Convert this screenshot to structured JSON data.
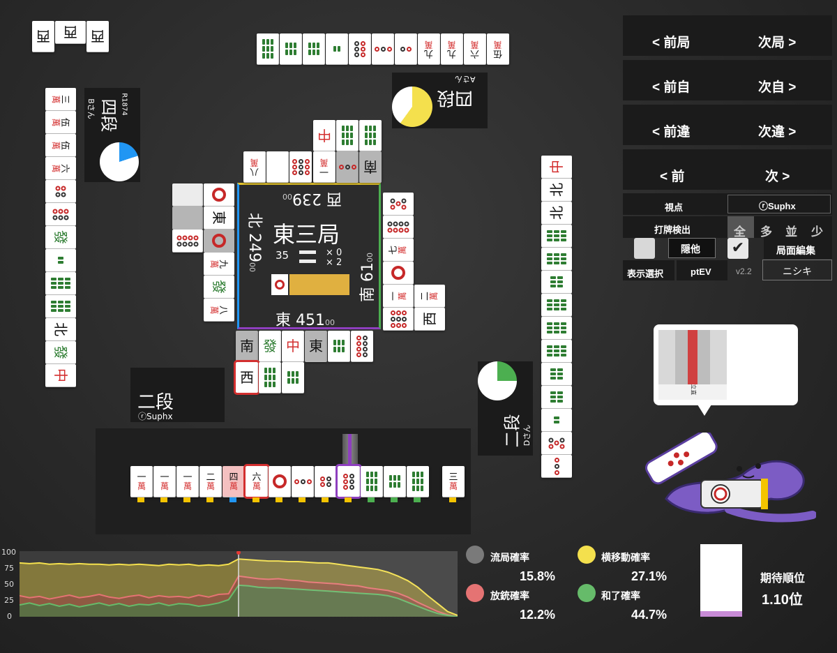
{
  "nav": {
    "prev_round": "< 前局",
    "next_round": "次局 >",
    "prev_self": "< 前自",
    "next_self": "次自 >",
    "prev_diff": "< 前違",
    "next_diff": "次違 >",
    "prev": "< 前",
    "next": "次 >"
  },
  "controls": {
    "viewpoint_label": "視点",
    "viewpoint_value": "ⓡSuphx",
    "discard_detect_label": "打牌検出",
    "filter_options": [
      "全",
      "多",
      "並",
      "少"
    ],
    "hide_other_label": "隠他",
    "board_edit_label": "局面編集",
    "display_select_label": "表示選択",
    "ptev_label": "ptEV",
    "version": "v2.2",
    "nishiki_label": "ニシキ"
  },
  "center": {
    "round": "東三局",
    "honba_count": "35",
    "stick_x0": "× 0",
    "stick_x2": "× 2",
    "scores": {
      "west": "西 239",
      "west_sub": "00",
      "north": "北 249",
      "north_sub": "00",
      "south": "南 61",
      "south_sub": "00",
      "east": "東 451",
      "east_sub": "00"
    }
  },
  "players": {
    "top": {
      "rank": "四段",
      "name": "Aさん",
      "gauge_pct": 60
    },
    "left": {
      "rank": "四段",
      "name": "Bさん",
      "rating": "R1874",
      "gauge_pct": 20
    },
    "right": {
      "rank": "二段",
      "name": "Dさん",
      "gauge_pct": 25
    },
    "bottom": {
      "rank": "二段",
      "name": "ⓡSuphx"
    }
  },
  "hand": [
    "一萬",
    "一萬",
    "一萬",
    "二萬",
    "四萬",
    "六萬",
    "1p",
    "3p",
    "4p",
    "6p",
    "9s",
    "5s",
    "9s"
  ],
  "hand_draw": "三萬",
  "stats": {
    "ryukyoku_label": "流局確率",
    "ryukyoku_value": "15.8%",
    "yokoido_label": "横移動確率",
    "yokoido_value": "27.1%",
    "houju_label": "放銃確率",
    "houju_value": "12.2%",
    "hora_label": "和了確率",
    "hora_value": "44.7%",
    "expected_rank_label": "期待順位",
    "expected_rank_value": "1.10位",
    "colors": {
      "ryukyoku": "#7a7a7a",
      "yokoido": "#f4e04d",
      "houju": "#e57373",
      "hora": "#66bb6a"
    }
  },
  "chart_data": {
    "type": "area",
    "ylim": [
      0,
      100
    ],
    "yticks": [
      "100",
      "75",
      "50",
      "25",
      "0"
    ],
    "series": [
      {
        "name": "横移動確率",
        "values": [
          82,
          81,
          82,
          80,
          81,
          80,
          81,
          80,
          80,
          79,
          80,
          79,
          80,
          79,
          78,
          80,
          79,
          80,
          78,
          79,
          78,
          80,
          88,
          87,
          86,
          85,
          85,
          84,
          84,
          83,
          82,
          82,
          80,
          78,
          76,
          74,
          72,
          68,
          62,
          55,
          45,
          32,
          20,
          8,
          2
        ]
      },
      {
        "name": "放銃確率",
        "values": [
          32,
          29,
          31,
          27,
          30,
          33,
          29,
          31,
          34,
          30,
          28,
          31,
          33,
          29,
          32,
          30,
          31,
          29,
          33,
          30,
          34,
          35,
          62,
          60,
          58,
          57,
          58,
          56,
          55,
          53,
          52,
          51,
          50,
          48,
          47,
          44,
          42,
          40,
          36,
          30,
          22,
          15,
          8,
          3,
          0
        ]
      },
      {
        "name": "和了確率",
        "values": [
          18,
          21,
          17,
          20,
          16,
          19,
          15,
          18,
          21,
          17,
          20,
          16,
          19,
          18,
          21,
          17,
          20,
          19,
          16,
          18,
          21,
          26,
          48,
          47,
          45,
          44,
          44,
          43,
          42,
          41,
          40,
          39,
          38,
          37,
          36,
          35,
          34,
          32,
          28,
          22,
          16,
          10,
          5,
          2,
          0
        ]
      }
    ],
    "marker_index": 22
  },
  "bubble": {
    "label": "立直"
  }
}
